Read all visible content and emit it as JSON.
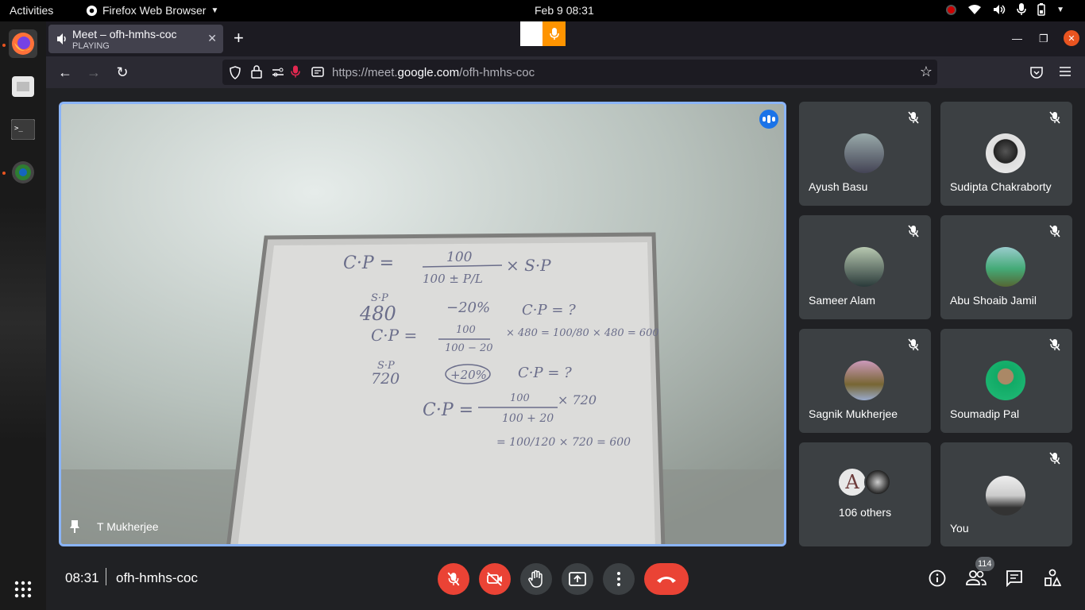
{
  "topbar": {
    "activities": "Activities",
    "app_name": "Firefox Web Browser",
    "clock": "Feb 9  08:31"
  },
  "browser": {
    "tab_title": "Meet – ofh-hmhs-coc",
    "tab_status": "PLAYING",
    "url_prefix": "https://meet.",
    "url_domain": "google.com",
    "url_path": "/ofh-hmhs-coc"
  },
  "meet": {
    "presenter_name": "T Mukherjee",
    "participants": [
      {
        "name": "Ayush Basu",
        "muted": true
      },
      {
        "name": "Sudipta Chakraborty",
        "muted": true
      },
      {
        "name": "Sameer Alam",
        "muted": true
      },
      {
        "name": "Abu Shoaib Jamil",
        "muted": true
      },
      {
        "name": "Sagnik Mukherjee",
        "muted": true
      },
      {
        "name": "Soumadip Pal",
        "muted": true
      },
      {
        "name": "You",
        "muted": true
      }
    ],
    "others_label": "106 others",
    "others_avatar_letter": "A",
    "time": "08:31",
    "meeting_code": "ofh-hmhs-coc",
    "people_count": "114"
  },
  "whiteboard_text": {
    "line1": "C·P =",
    "num1": "100",
    "den1": "100 ± P/L",
    "mul1": "× S·P",
    "sp1": "S·P",
    "v480": "480",
    "m20": "−20%",
    "cq1": "C·P = ?",
    "cp2": "C·P =",
    "f2num": "100",
    "f2den": "100 − 20",
    "f2rest": "× 480 = 100/80 × 480 = 600",
    "sp2": "S·P",
    "v720": "720",
    "p20": "+20%",
    "cq2": "C·P = ?",
    "cp3": "C·P =",
    "f3num": "100",
    "f3den": "100 + 20",
    "f3rest": "× 720",
    "f3res": "= 100/120 × 720 = 600"
  },
  "colors": {
    "accent": "#8ab4f8",
    "end_call": "#ea4335",
    "firefox_orange": "#ff9400"
  }
}
